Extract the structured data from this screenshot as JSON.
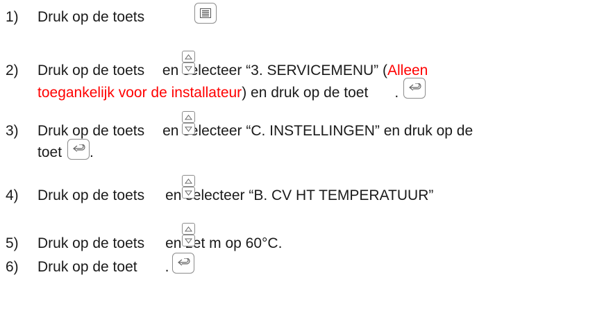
{
  "steps": [
    {
      "number": "1)",
      "text_1": "Druk op de toets",
      "key_1_icon": "list-menu-icon"
    },
    {
      "number": "2)",
      "text_1": "Druk op de toets",
      "key_up_icon": "triangle-up-icon",
      "key_down_icon": "triangle-down-icon",
      "text_2": " en selecteer “3. SERVICEMENU” (",
      "text_red": "Alleen",
      "text_red_2": "toegankelijk voor de installateur",
      "text_3": ") en druk op de toet",
      "text_4": ".",
      "key_enter_icon": "return-arrow-icon"
    },
    {
      "number": "3)",
      "text_1": "Druk op de toets",
      "text_2": "en selecteer “C. INSTELLINGEN” en druk op de",
      "text_3": "toet",
      "text_4": "."
    },
    {
      "number": "4)",
      "text_1": "Druk op de toets",
      "text_2": "en selecteer “B. CV HT TEMPERATUUR”"
    },
    {
      "number": "5)",
      "text_1": "Druk op de toets",
      "text_2": "en zet m op 60°C."
    },
    {
      "number": "6)",
      "text_1": "Druk op de toet",
      "text_2": "."
    }
  ],
  "colors": {
    "text": "#1a1a1a",
    "highlight": "#ff0000",
    "key_border": "#8c8c8c"
  }
}
